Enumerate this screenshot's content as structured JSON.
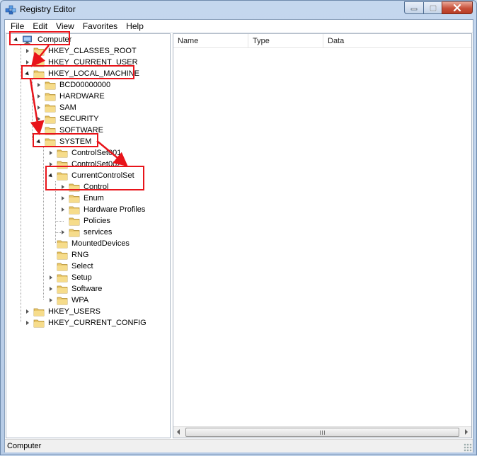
{
  "window": {
    "title": "Registry Editor",
    "app_icon": "registry-icon",
    "minimize_icon": "minimize-icon",
    "maximize_icon": "maximize-icon",
    "close_icon": "close-icon"
  },
  "menu": [
    {
      "label": "File"
    },
    {
      "label": "Edit"
    },
    {
      "label": "View"
    },
    {
      "label": "Favorites"
    },
    {
      "label": "Help"
    }
  ],
  "tree": {
    "root": "Computer",
    "hkcr": "HKEY_CLASSES_ROOT",
    "hkcu": "HKEY_CURRENT_USER",
    "hklm": "HKEY_LOCAL_MACHINE",
    "hklm_children": {
      "bcd": "BCD00000000",
      "hardware": "HARDWARE",
      "sam": "SAM",
      "security": "SECURITY",
      "software": "SOFTWARE",
      "system": "SYSTEM"
    },
    "system_children": {
      "cs1": "ControlSet001",
      "cs2": "ControlSet002",
      "ccs": "CurrentControlSet",
      "mounted": "MountedDevices",
      "rng": "RNG",
      "select": "Select",
      "setup": "Setup",
      "software": "Software",
      "wpa": "WPA"
    },
    "ccs_children": {
      "control": "Control",
      "enum": "Enum",
      "hwprofiles": "Hardware Profiles",
      "policies": "Policies",
      "services": "services"
    },
    "hku": "HKEY_USERS",
    "hkcc": "HKEY_CURRENT_CONFIG"
  },
  "list": {
    "columns": [
      {
        "label": "Name"
      },
      {
        "label": "Type"
      },
      {
        "label": "Data"
      }
    ]
  },
  "status": {
    "path": "Computer"
  },
  "annotation_color": "#e8141a",
  "folder_color": "#e9c76a"
}
